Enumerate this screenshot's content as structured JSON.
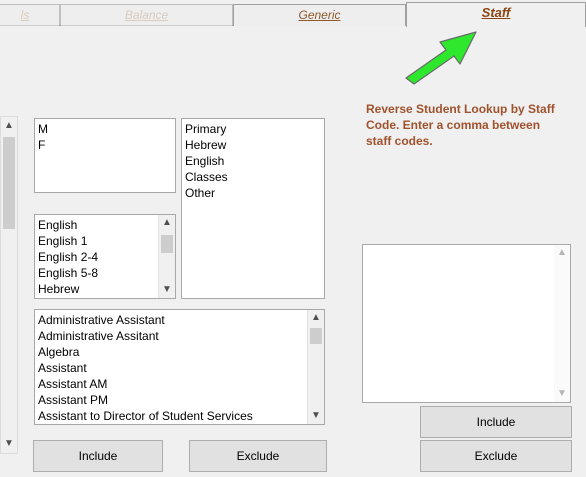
{
  "tabs": [
    {
      "label": "ls",
      "state": "faded"
    },
    {
      "label": "Balance",
      "state": "faded"
    },
    {
      "label": "Generic",
      "state": "normal"
    },
    {
      "label": "Staff",
      "state": "active"
    }
  ],
  "gender_list": {
    "items": [
      "M",
      "F"
    ]
  },
  "category_list": {
    "items": [
      "Primary",
      "Hebrew",
      "English",
      "Classes",
      "Other"
    ]
  },
  "subject_list": {
    "items": [
      "English",
      "English 1",
      "English 2-4",
      "English 5-8",
      "Hebrew"
    ]
  },
  "position_list": {
    "items": [
      "Administrative Assistant",
      "Administrative Assitant",
      "Algebra",
      "Assistant",
      "Assistant AM",
      "Assistant PM",
      "Assistant to Director of Student Services"
    ]
  },
  "left_buttons": {
    "include": "Include",
    "exclude": "Exclude"
  },
  "staff_panel": {
    "instructions": "Reverse Student Lookup by Staff Code. Enter a comma between staff codes.",
    "codes_value": "",
    "include": "Include",
    "exclude": "Exclude"
  },
  "colors": {
    "accent_text": "#a0522d",
    "arrow_fill": "#33ff33"
  },
  "icons": {
    "scroll_up": "▲",
    "scroll_down": "▼"
  }
}
